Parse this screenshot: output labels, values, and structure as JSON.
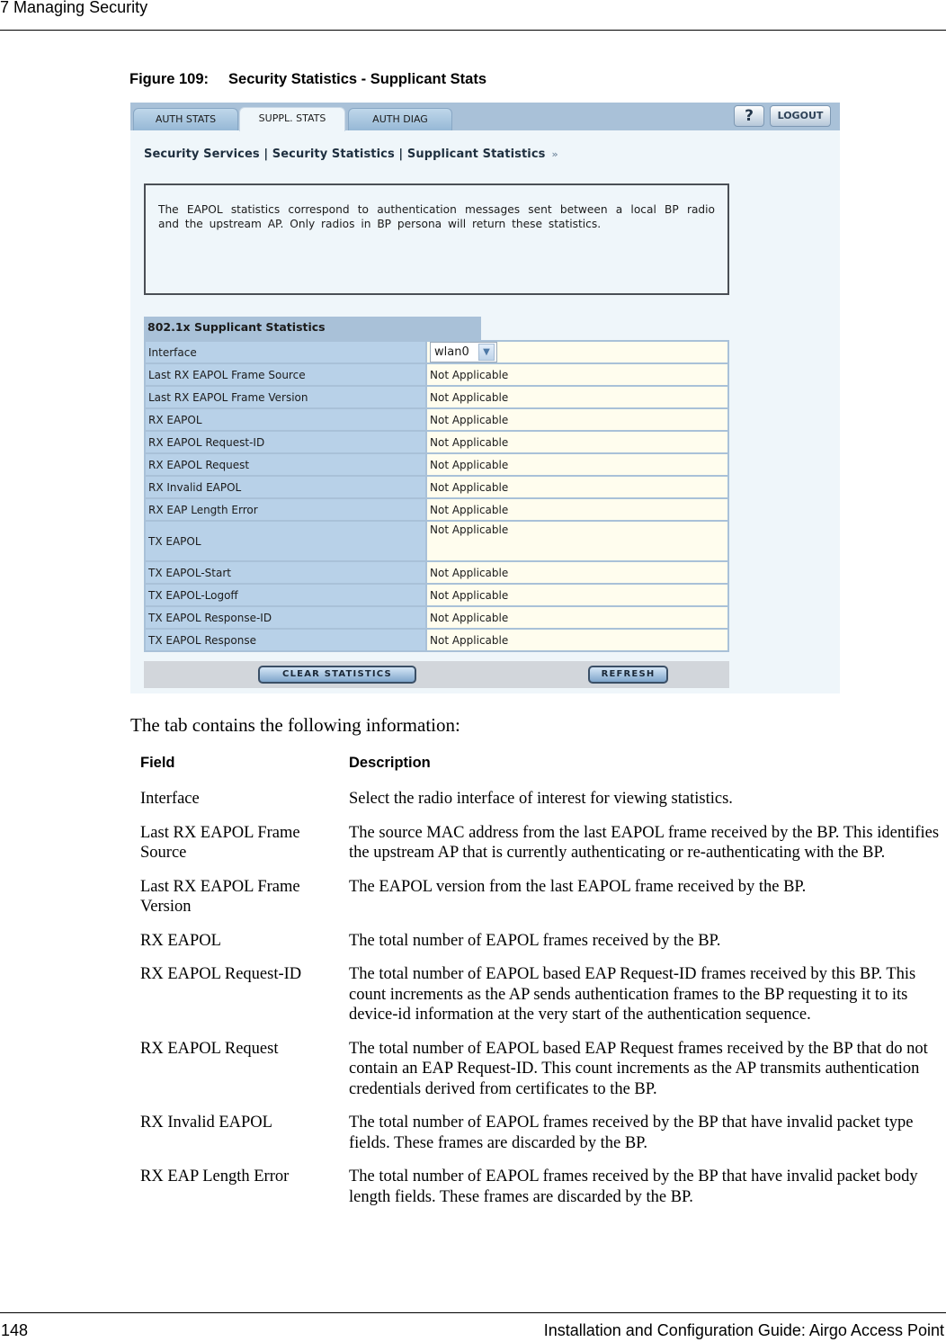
{
  "page": {
    "running_head": "7  Managing Security",
    "figure_label": "Figure 109:",
    "figure_title": "Security Statistics - Supplicant Stats",
    "intro_text": "The tab contains the following information:",
    "footer_page_number": "148",
    "footer_title": "Installation and Configuration Guide: Airgo Access Point"
  },
  "screenshot": {
    "tabs": [
      {
        "label": "AUTH STATS",
        "active": false
      },
      {
        "label": "SUPPL. STATS",
        "active": true
      },
      {
        "label": "AUTH DIAG",
        "active": false
      }
    ],
    "help_label": "?",
    "logout_label": "LOGOUT",
    "breadcrumb": "Security Services | Security Statistics | Supplicant Statistics",
    "breadcrumb_arrow": "»",
    "info_text": "The EAPOL statistics correspond to authentication messages sent between a local BP radio and the upstream AP. Only radios in BP persona will return these statistics.",
    "section_title": "802.1x Supplicant Statistics",
    "interface_label": "Interface",
    "interface_value": "wlan0",
    "rows": [
      {
        "label": "Last RX EAPOL Frame Source",
        "value": "Not Applicable"
      },
      {
        "label": "Last RX EAPOL Frame Version",
        "value": "Not Applicable"
      },
      {
        "label": "RX EAPOL",
        "value": "Not Applicable"
      },
      {
        "label": "RX EAPOL Request-ID",
        "value": "Not Applicable"
      },
      {
        "label": "RX EAPOL Request",
        "value": "Not Applicable"
      },
      {
        "label": "RX Invalid EAPOL",
        "value": "Not Applicable"
      },
      {
        "label": "RX EAP Length Error",
        "value": "Not Applicable"
      },
      {
        "label": "TX EAPOL",
        "value": "Not Applicable"
      },
      {
        "label": "TX EAPOL-Start",
        "value": "Not Applicable"
      },
      {
        "label": "TX EAPOL-Logoff",
        "value": "Not Applicable"
      },
      {
        "label": "TX EAPOL Response-ID",
        "value": "Not Applicable"
      },
      {
        "label": "TX EAPOL Response",
        "value": "Not Applicable"
      }
    ],
    "clear_label": "CLEAR STATISTICS",
    "refresh_label": "REFRESH"
  },
  "field_table": {
    "headers": {
      "field": "Field",
      "description": "Description"
    },
    "rows": [
      {
        "field": "Interface",
        "description": "Select the radio interface of interest for viewing statistics."
      },
      {
        "field": "Last RX EAPOL Frame Source",
        "description": "The source MAC address from the last EAPOL frame received by the BP. This identifies the upstream AP that is currently authenticating or re-authenticating with the BP."
      },
      {
        "field": "Last RX EAPOL Frame Version",
        "description": "The EAPOL version from the last EAPOL frame received by the BP."
      },
      {
        "field": "RX EAPOL",
        "description": "The total number of EAPOL frames received by the BP."
      },
      {
        "field": "RX EAPOL Request-ID",
        "description": "The total number of EAPOL based EAP Request-ID frames received by this BP. This count increments as the AP sends authentication frames to the BP requesting it to its device-id information at the very start of the authentication sequence."
      },
      {
        "field": "RX EAPOL Request",
        "description": "The total number of EAPOL based EAP Request frames received by the BP that do not contain an EAP Request-ID. This count increments as the AP transmits authentication credentials derived from certificates to the BP."
      },
      {
        "field": "RX Invalid EAPOL",
        "description": "The total number of EAPOL frames received by the BP that have invalid packet type fields. These frames are discarded by the BP."
      },
      {
        "field": "RX EAP Length Error",
        "description": "The total number of EAPOL frames received by the BP that have invalid packet body length fields. These frames are discarded by the BP."
      }
    ]
  }
}
